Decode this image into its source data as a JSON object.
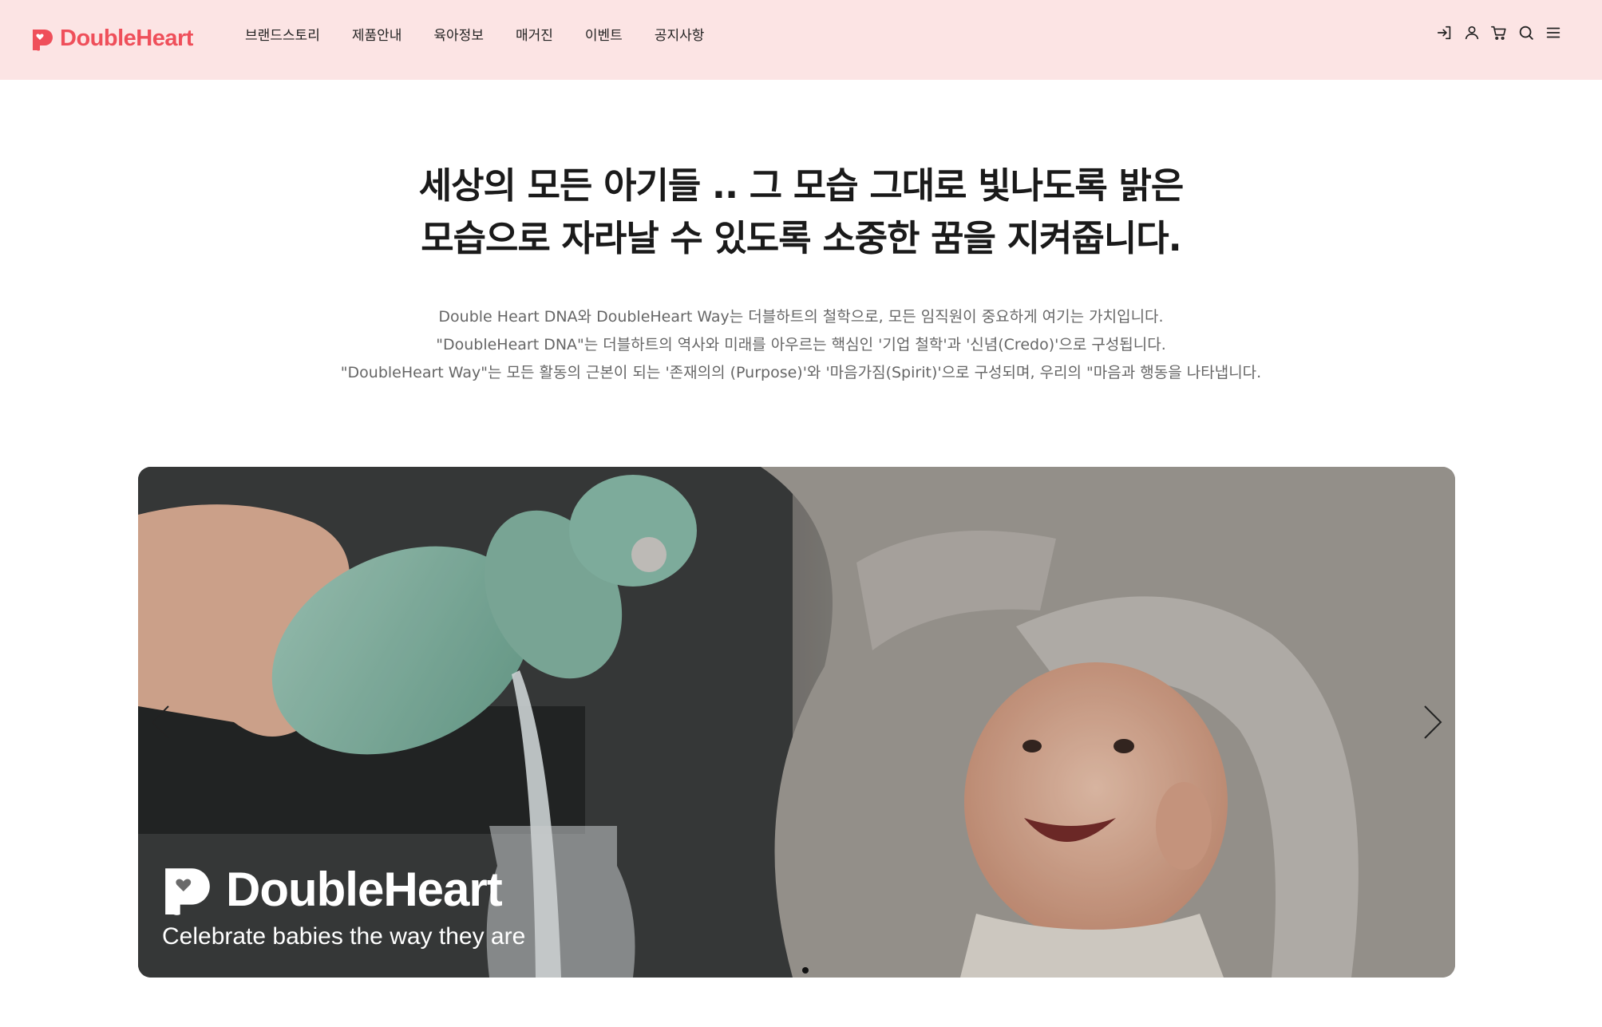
{
  "brand": {
    "name": "DoubleHeart",
    "color": "#ef4f5a"
  },
  "header": {
    "background": "#fce4e4"
  },
  "nav": {
    "items": [
      {
        "label": "브랜드스토리"
      },
      {
        "label": "제품안내"
      },
      {
        "label": "육아정보"
      },
      {
        "label": "매거진"
      },
      {
        "label": "이벤트"
      },
      {
        "label": "공지사항"
      }
    ]
  },
  "utility_icons": [
    "login-icon",
    "user-icon",
    "cart-icon",
    "search-icon",
    "menu-icon"
  ],
  "hero": {
    "headline_line1": "세상의 모든 아기들 .. 그 모습 그대로 빛나도록 밝은",
    "headline_line2": "모습으로 자라날 수 있도록 소중한 꿈을 지켜줍니다.",
    "desc_line1": "Double Heart DNA와 DoubleHeart Way는 더블하트의 철학으로, 모든 임직원이 중요하게 여기는 가치입니다.",
    "desc_line2": "\"DoubleHeart DNA\"는 더블하트의 역사와 미래를 아우르는 핵심인 '기업 철학'과 '신념(Credo)'으로 구성됩니다.",
    "desc_line3": "\"DoubleHeart Way\"는 모든 활동의 근본이 되는 '존재의의 (Purpose)'와 '마음가짐(Spirit)'으로 구성되며, 우리의 \"마음과 행동을 나타냅니다."
  },
  "banner": {
    "brand": "DoubleHeart",
    "tagline": "Celebrate babies the way they are",
    "slide_count": 1,
    "active_slide": 1
  }
}
